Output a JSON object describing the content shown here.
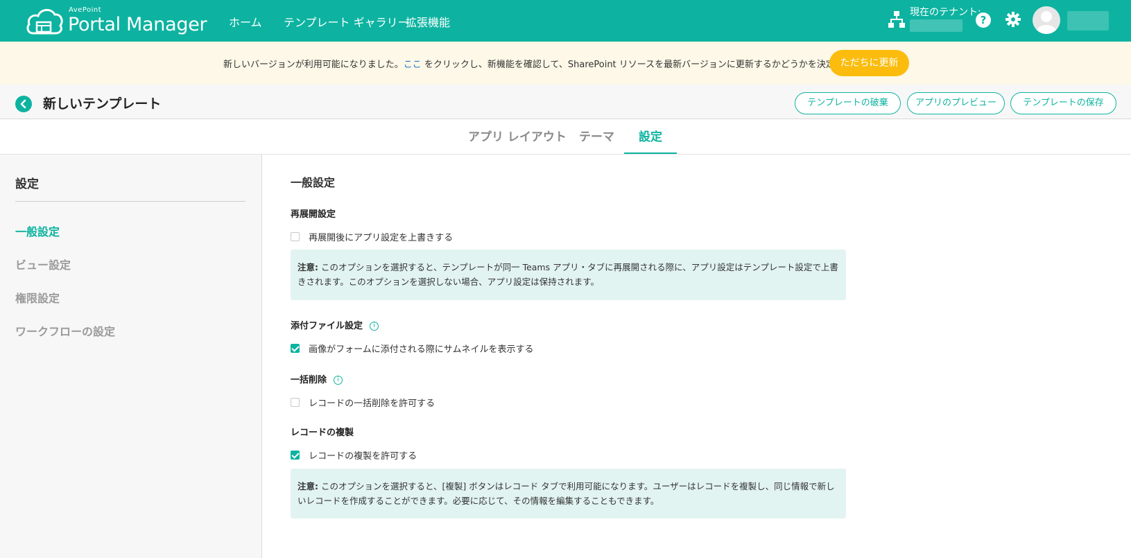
{
  "topbar": {
    "logo_small": "AvePoint",
    "logo_big": "Portal Manager",
    "nav": [
      "ホーム",
      "テンプレート ギャラリー",
      "拡張機能"
    ],
    "tenant_label": "現在のテナント:",
    "icons": [
      "cloud-logo-icon",
      "org-tree-icon",
      "help-icon",
      "gear-icon",
      "avatar-icon"
    ]
  },
  "banner": {
    "text_before": "新しいバージョンが利用可能になりました。",
    "link": "ここ",
    "text_after": " をクリックし、新機能を確認して、SharePoint リソースを最新バージョンに更新するかどうかを決定してください。",
    "button": "ただちに更新"
  },
  "header": {
    "title": "新しいテンプレート",
    "buttons": {
      "discard": "テンプレートの破棄",
      "preview": "アプリのプレビュー",
      "save": "テンプレートの保存"
    }
  },
  "tabs": {
    "items": [
      "アプリ レイアウト",
      "テーマ",
      "設定"
    ],
    "active": "設定"
  },
  "sidebar": {
    "title": "設定",
    "items": [
      "一般設定",
      "ビュー設定",
      "権限設定",
      "ワークフローの設定"
    ],
    "active": "一般設定"
  },
  "main": {
    "title": "一般設定",
    "redeploy": {
      "title": "再展開設定",
      "checkbox_label": "再展開後にアプリ設定を上書きする",
      "checked": false,
      "note_label": "注意:",
      "note_text": " このオプションを選択すると、テンプレートが同一 Teams アプリ・タブに再展開される際に、アプリ設定はテンプレート設定で上書きされます。このオプションを選択しない場合、アプリ設定は保持されます。"
    },
    "attachment": {
      "title": "添付ファイル設定",
      "checkbox_label": "画像がフォームに添付される際にサムネイルを表示する",
      "checked": true
    },
    "bulk_delete": {
      "title": "一括削除",
      "checkbox_label": "レコードの一括削除を許可する",
      "checked": false
    },
    "duplicate": {
      "title": "レコードの複製",
      "checkbox_label": "レコードの複製を許可する",
      "checked": true,
      "note_label": "注意:",
      "note_text": " このオプションを選択すると、[複製] ボタンはレコード タブで利用可能になります。ユーザーはレコードを複製し、同じ情報で新しいレコードを作成することができます。必要に応じて、その情報を編集することもできます。"
    }
  },
  "colors": {
    "brand": "#0db3a0",
    "banner_bg": "#fdf8e7",
    "update_button": "#fbbc0d",
    "note_bg": "#e2f4f1",
    "link": "#1a73c8"
  }
}
